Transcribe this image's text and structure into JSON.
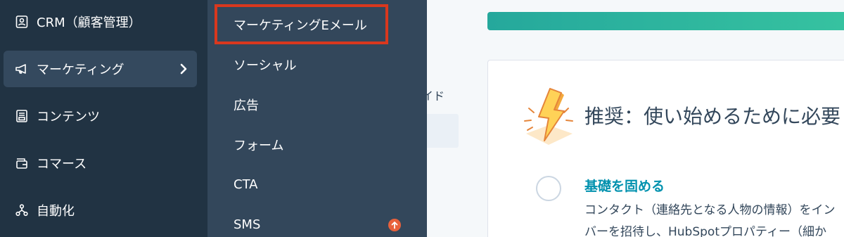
{
  "sidebar": {
    "items": [
      {
        "label": "CRM（顧客管理）",
        "icon": "contacts-icon"
      },
      {
        "label": "マーケティング",
        "icon": "megaphone-icon",
        "active": true,
        "chevron_icon": "chevron-right-icon"
      },
      {
        "label": "コンテンツ",
        "icon": "content-icon"
      },
      {
        "label": "コマース",
        "icon": "wallet-icon"
      },
      {
        "label": "自動化",
        "icon": "automation-icon"
      }
    ]
  },
  "flyout": {
    "items": [
      {
        "label": "マーケティングEメール",
        "highlighted": true
      },
      {
        "label": "ソーシャル"
      },
      {
        "label": "広告"
      },
      {
        "label": "フォーム"
      },
      {
        "label": "CTA"
      },
      {
        "label": "SMS",
        "badge_icon": "upgrade-arrow-icon"
      }
    ]
  },
  "main": {
    "partial_text": "イド",
    "card": {
      "icon": "lightning-bolt-icon",
      "heading": "推奨：使い始めるために必要",
      "task": {
        "status_icon": "empty-circle-icon",
        "title": "基礎を固める",
        "description_lines": [
          "コンタクト（連絡先となる人物の情報）をイン",
          "バーを招待し、HubSpotプロパティー（細か"
        ]
      }
    }
  },
  "colors": {
    "sidebar_bg": "#213343",
    "sidebar_active_bg": "#34495e",
    "flyout_bg": "#33475b",
    "highlight_border": "#d9381e",
    "main_bg": "#f5f8fa",
    "progress_bar": "#2fb9a0",
    "link_teal": "#0091ae",
    "badge": "#e8613c"
  }
}
